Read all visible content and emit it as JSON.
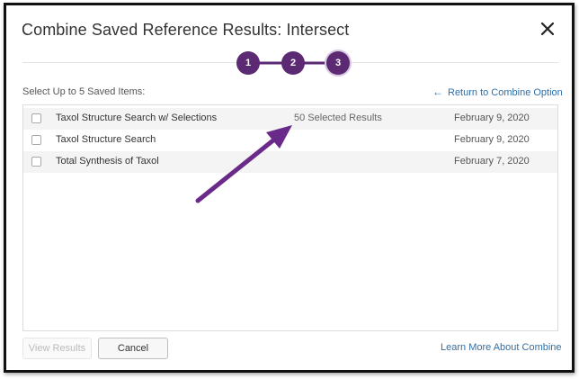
{
  "dialog": {
    "title": "Combine Saved Reference Results: Intersect",
    "close_icon": "close-icon"
  },
  "stepper": {
    "steps": [
      {
        "label": "1",
        "state": "complete"
      },
      {
        "label": "2",
        "state": "complete"
      },
      {
        "label": "3",
        "state": "current"
      }
    ],
    "color": "#5b2a73"
  },
  "selection": {
    "label": "Select Up to 5 Saved Items:",
    "return_link": "Return to Combine Option"
  },
  "items": [
    {
      "name": "Taxol Structure Search w/ Selections",
      "count": "50 Selected Results",
      "date": "February 9, 2020",
      "checked": false
    },
    {
      "name": "Taxol Structure Search",
      "count": "",
      "date": "February 9, 2020",
      "checked": false
    },
    {
      "name": "Total Synthesis of Taxol",
      "count": "",
      "date": "February 7, 2020",
      "checked": false
    }
  ],
  "footer": {
    "view_results": "View Results",
    "cancel": "Cancel",
    "learn_more": "Learn More About Combine"
  },
  "annotation": {
    "arrow_color": "#6a2a8a",
    "points_to": "50 Selected Results"
  }
}
